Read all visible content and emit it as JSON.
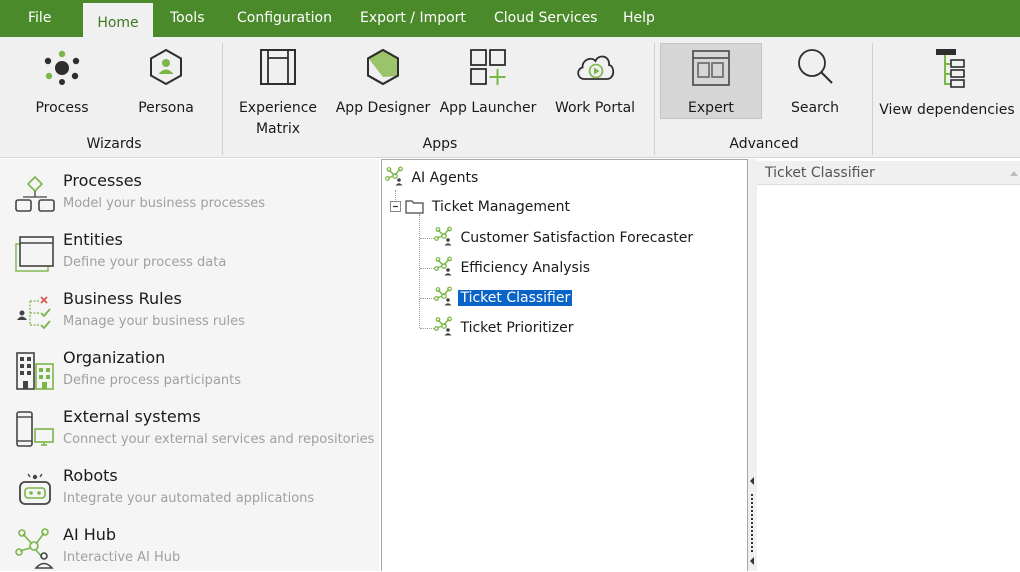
{
  "menu": [
    "File",
    "Home",
    "Tools",
    "Configuration",
    "Export / Import",
    "Cloud Services",
    "Help"
  ],
  "ribbon": {
    "wizards": {
      "label": "Wizards",
      "process": "Process",
      "persona": "Persona"
    },
    "apps": {
      "label": "Apps",
      "experience_matrix_1": "Experience",
      "experience_matrix_2": "Matrix",
      "app_designer": "App Designer",
      "app_launcher": "App Launcher",
      "work_portal": "Work Portal"
    },
    "advanced": {
      "label": "Advanced",
      "expert": "Expert",
      "search": "Search"
    },
    "view_dependencies": "View dependencies"
  },
  "nav": [
    {
      "title": "Processes",
      "subtitle": "Model your business processes"
    },
    {
      "title": "Entities",
      "subtitle": "Define your process data"
    },
    {
      "title": "Business Rules",
      "subtitle": "Manage your business rules"
    },
    {
      "title": "Organization",
      "subtitle": "Define process participants"
    },
    {
      "title": "External systems",
      "subtitle": "Connect your external services and repositories"
    },
    {
      "title": "Robots",
      "subtitle": "Integrate your automated applications"
    },
    {
      "title": "AI Hub",
      "subtitle": "Interactive AI Hub"
    }
  ],
  "tree": {
    "root": "AI Agents",
    "folder": "Ticket Management",
    "children": [
      "Customer Satisfaction Forecaster",
      "Efficiency Analysis",
      "Ticket Classifier",
      "Ticket Prioritizer"
    ],
    "selected": "Ticket Classifier"
  },
  "detail": {
    "header": "Ticket Classifier"
  },
  "colors": {
    "brand": "#4a8a2a",
    "icon_green": "#7ab648",
    "selection": "#0a64c8"
  }
}
